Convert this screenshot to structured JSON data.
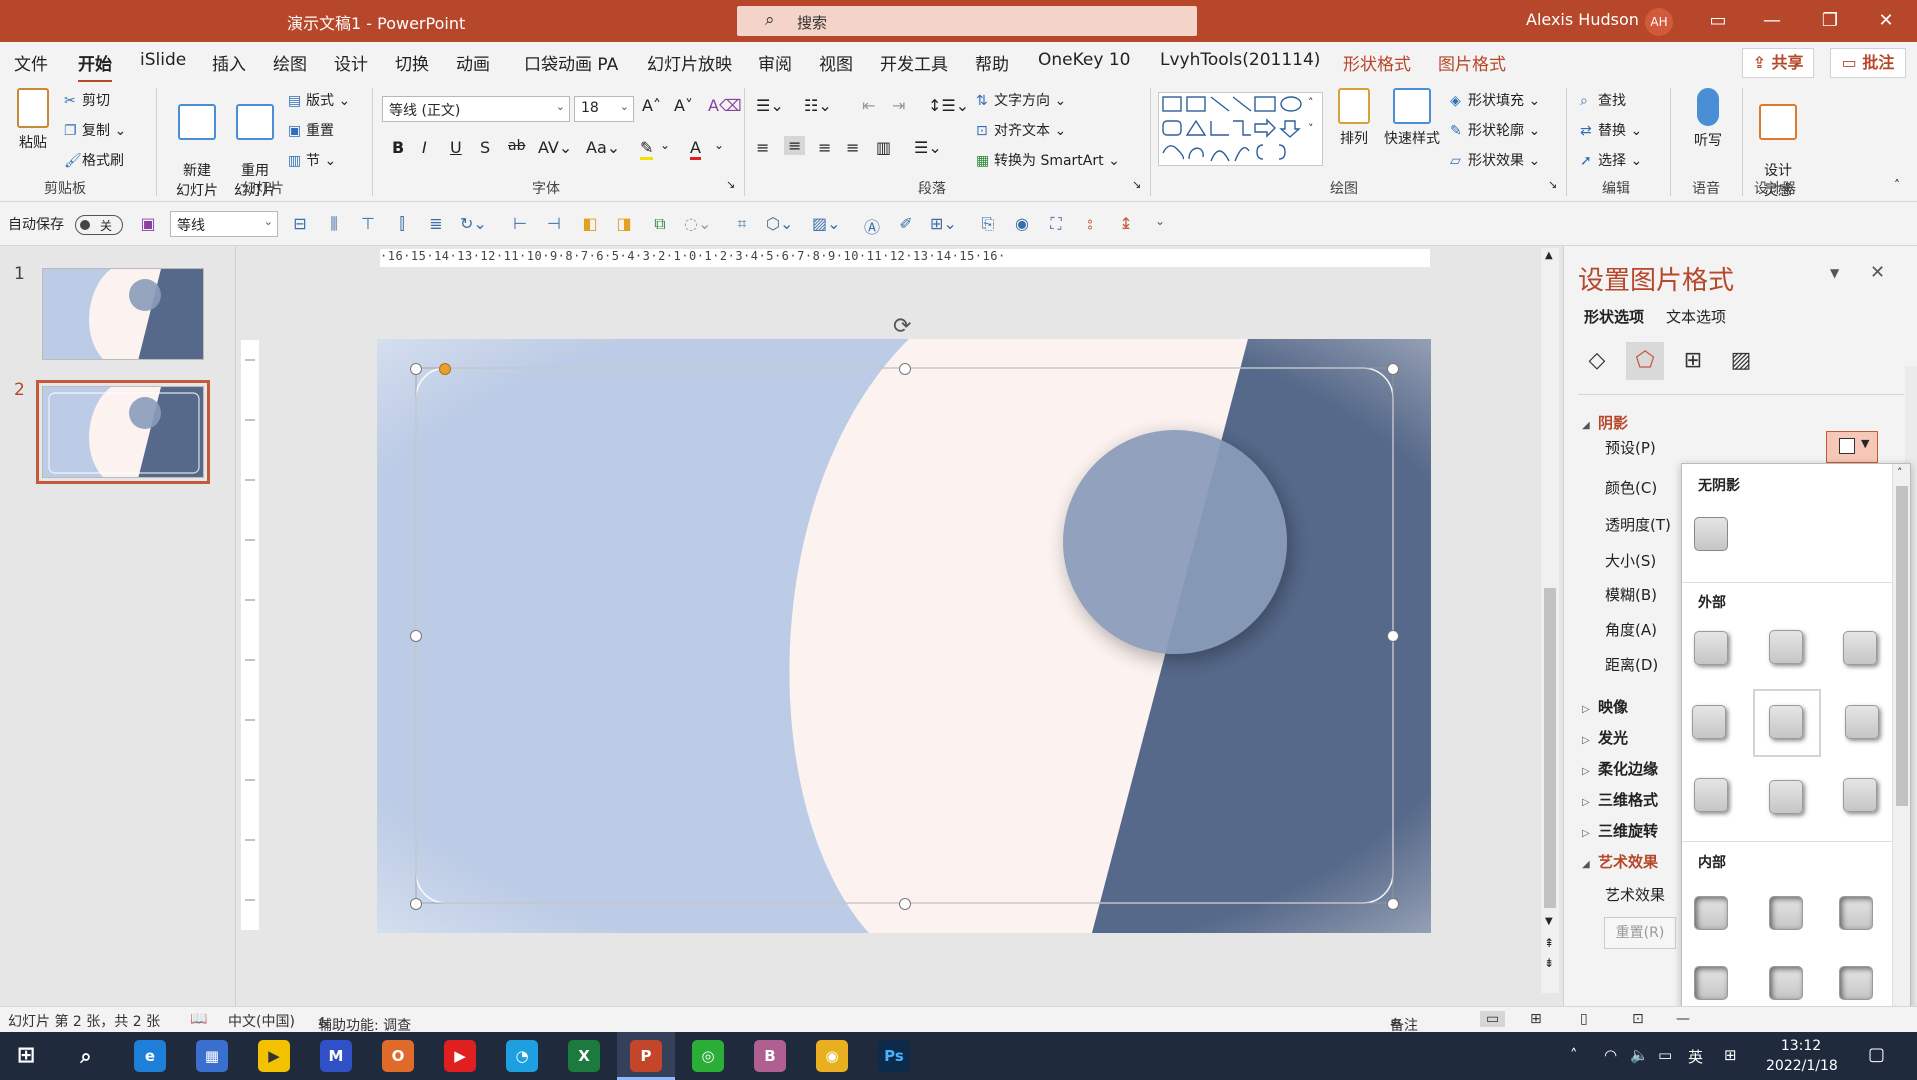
{
  "titlebar": {
    "doc_title": "演示文稿1 - PowerPoint",
    "search_placeholder": "搜索",
    "user_name": "Alexis Hudson",
    "user_initials": "AH"
  },
  "tabs": [
    "文件",
    "开始",
    "iSlide",
    "插入",
    "绘图",
    "设计",
    "切换",
    "动画",
    "口袋动画 PA",
    "幻灯片放映",
    "审阅",
    "视图",
    "开发工具",
    "帮助",
    "OneKey 10",
    "LvyhTools(201114)",
    "形状格式",
    "图片格式"
  ],
  "share_label": "共享",
  "comment_label": "批注",
  "ribbon": {
    "paste": "粘贴",
    "cut": "剪切",
    "copy": "复制",
    "format_painter": "格式刷",
    "clipboard": "剪贴板",
    "new_slide": "新建\n幻灯片",
    "reuse_slide": "重用\n幻灯片",
    "layout": "版式",
    "reset": "重置",
    "section": "节",
    "slides": "幻灯片",
    "font_name": "等线 (正文)",
    "font_size": "18",
    "font": "字体",
    "text_direction": "文字方向",
    "align_text": "对齐文本",
    "convert_smartart": "转换为 SmartArt",
    "paragraph": "段落",
    "arrange": "排列",
    "quick_styles": "快速样式",
    "shape_fill": "形状填充",
    "shape_outline": "形状轮廓",
    "shape_effects": "形状效果",
    "drawing": "绘图",
    "find": "查找",
    "replace": "替换",
    "select": "选择",
    "editing": "编辑",
    "dictate": "听写",
    "voice": "语音",
    "design_ideas": "设计\n灵感",
    "designer": "设计器"
  },
  "qat": {
    "autosave": "自动保存",
    "toggle_state": "关",
    "font_combo": "等线"
  },
  "slides": [
    {
      "number": "1"
    },
    {
      "number": "2"
    }
  ],
  "ruler_text": "·16·15·14·13·12·11·10·9·8·7·6·5·4·3·2·1·0·1·2·3·4·5·6·7·8·9·10·11·12·13·14·15·16·",
  "pane": {
    "title": "设置图片格式",
    "tab_shape": "形状选项",
    "tab_text": "文本选项",
    "shadow": "阴影",
    "preset": "预设(P)",
    "color": "颜色(C)",
    "transparency": "透明度(T)",
    "size": "大小(S)",
    "blur": "模糊(B)",
    "angle": "角度(A)",
    "distance": "距离(D)",
    "reflection": "映像",
    "glow": "发光",
    "soft_edges": "柔化边缘",
    "three_d_format": "三维格式",
    "three_d_rotation": "三维旋转",
    "artistic_effects": "艺术效果",
    "artistic_effects_item": "艺术效果",
    "reset_button": "重置(R)"
  },
  "shadow_dropdown": {
    "no_shadow": "无阴影",
    "outer": "外部",
    "inner": "内部"
  },
  "status": {
    "slide_info": "幻灯片 第 2 张，共 2 张",
    "language": "中文(中国)",
    "accessibility": "辅助功能: 调查",
    "notes": "备注"
  },
  "taskbar": {
    "ime": "英",
    "time": "13:12",
    "date": "2022/1/18"
  },
  "colors": {
    "accent": "#b7472a",
    "slide_light_blue": "#bccce6",
    "slide_cream": "#fcf3f0",
    "slide_dark_blue": "#56698a",
    "slide_circle": "#8a9cba"
  }
}
